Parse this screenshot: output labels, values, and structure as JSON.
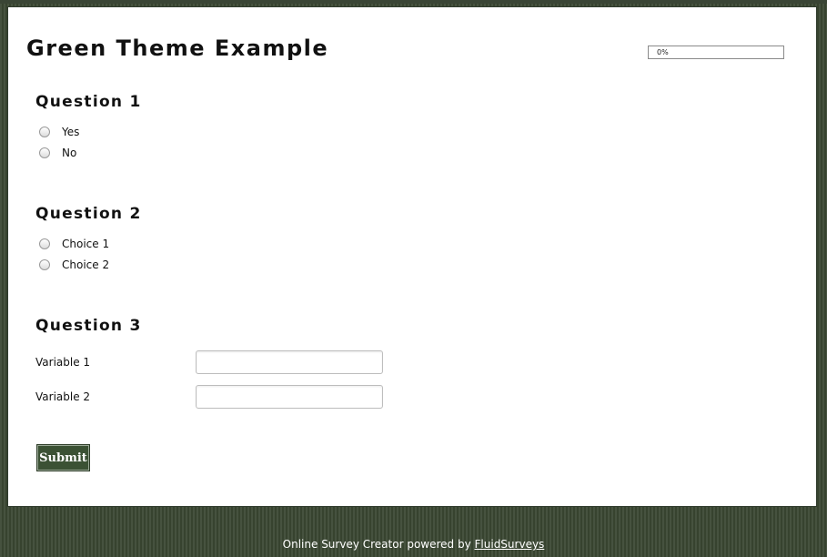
{
  "page": {
    "title": "Green Theme Example",
    "progress": {
      "label": "0%",
      "value": 0
    }
  },
  "questions": [
    {
      "title": "Question 1",
      "options": [
        "Yes",
        "No"
      ]
    },
    {
      "title": "Question 2",
      "options": [
        "Choice 1",
        "Choice 2"
      ]
    },
    {
      "title": "Question 3",
      "fields": [
        {
          "label": "Variable 1",
          "value": ""
        },
        {
          "label": "Variable 2",
          "value": ""
        }
      ]
    }
  ],
  "submit_label": "Submit",
  "footer": {
    "text": "Online Survey Creator powered by ",
    "link_text": "FluidSurveys"
  },
  "colors": {
    "background": "#3e4a38",
    "button": "#3b5134",
    "panel": "#ffffff"
  }
}
